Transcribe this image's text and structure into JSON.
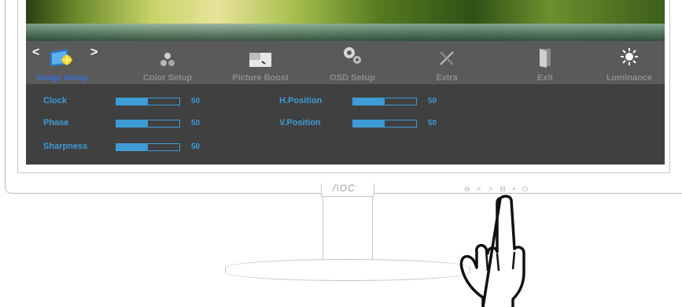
{
  "brand": {
    "logo_text": "/\\OC"
  },
  "menu": {
    "prev_arrow": "<",
    "next_arrow": ">",
    "tabs": [
      {
        "label": "Image Setup",
        "icon": "image-setup-icon",
        "active": true
      },
      {
        "label": "Color Setup",
        "icon": "color-setup-icon"
      },
      {
        "label": "Picture Boost",
        "icon": "picture-boost-icon"
      },
      {
        "label": "OSD Setup",
        "icon": "osd-setup-icon"
      },
      {
        "label": "Extra",
        "icon": "extra-tools-icon"
      },
      {
        "label": "Exit",
        "icon": "exit-door-icon"
      },
      {
        "label": "Luminance",
        "icon": "luminance-sun-icon"
      }
    ]
  },
  "settings": {
    "left": [
      {
        "label": "Clock",
        "value": "50",
        "level": 0.5
      },
      {
        "label": "Phase",
        "value": "50",
        "level": 0.5
      },
      {
        "label": "Sharpness",
        "value": "50",
        "level": 0.5
      }
    ],
    "right": [
      {
        "label": "H.Position",
        "value": "50",
        "level": 0.5
      },
      {
        "label": "V.Position",
        "value": "50",
        "level": 0.5
      }
    ]
  },
  "front_buttons": [
    "power-button-icon",
    "left-button-icon",
    "right-button-icon",
    "menu-button-icon",
    "led-indicator-icon",
    "power-icon"
  ],
  "colors": {
    "accent": "#3d9bd6",
    "active_tab": "#3a6fd0",
    "menu_bg": "#5a5a5a",
    "content_bg": "#404040"
  }
}
